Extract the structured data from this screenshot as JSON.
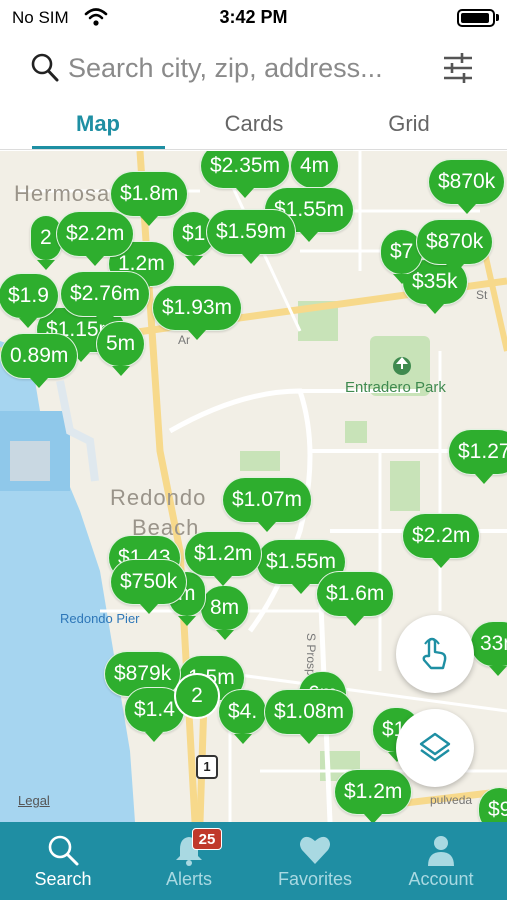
{
  "status_bar": {
    "carrier": "No SIM",
    "time": "3:42 PM"
  },
  "search": {
    "placeholder": "Search city, zip, address...",
    "value": ""
  },
  "tabs": [
    {
      "label": "Map",
      "active": true
    },
    {
      "label": "Cards",
      "active": false
    },
    {
      "label": "Grid",
      "active": false
    }
  ],
  "map": {
    "places": [
      "Hermosa",
      "Redondo",
      "Beach"
    ],
    "park": "Entradero Park",
    "water_label": "Redondo Pier",
    "streets": [
      "S Prosp",
      "pulveda",
      "St",
      "Ar"
    ],
    "route": "1",
    "legal": "Legal",
    "pins": [
      "$2.35m",
      "4m",
      "$1.8m",
      "$870k",
      "2",
      "$2.2m",
      "$1",
      "$1.59m",
      "$1.55m",
      "$7",
      "$870k",
      "1.2m",
      "$35k",
      "$1.9",
      "$2.76m",
      "$1.93m",
      "$1.15m",
      "5m",
      "0.89m",
      "$1.27",
      "$1.07m",
      "$2.2m",
      "$1.43",
      "$1.2m",
      "$1.55m",
      "$750k",
      "m",
      "8m",
      "$1.6m",
      "33n",
      "$879k",
      "1.5m",
      "$1.4",
      "$4.",
      "$1.08m",
      "6m",
      "$1.",
      "$1.2m",
      "$9"
    ],
    "clusters": [
      "2"
    ]
  },
  "bottom_nav": [
    {
      "label": "Search",
      "active": true,
      "icon": "search-icon"
    },
    {
      "label": "Alerts",
      "active": false,
      "icon": "bell-icon",
      "badge": "25"
    },
    {
      "label": "Favorites",
      "active": false,
      "icon": "heart-icon"
    },
    {
      "label": "Account",
      "active": false,
      "icon": "person-icon"
    }
  ],
  "colors": {
    "accent": "#1e8fa3",
    "pin": "#2eae2e",
    "nav": "#1f8ea3",
    "badge": "#c0392b"
  }
}
